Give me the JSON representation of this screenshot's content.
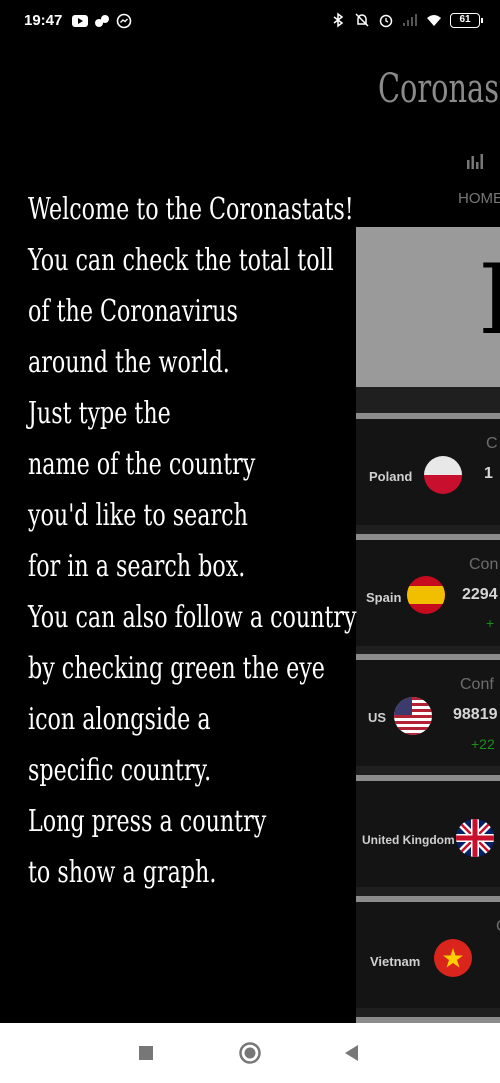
{
  "status_bar": {
    "time": "19:47",
    "battery": "61",
    "left_icons": [
      "youtube-icon",
      "notification-icon",
      "messenger-icon"
    ],
    "right_icons": [
      "bluetooth-icon",
      "mute-icon",
      "alarm-icon",
      "signal-icon",
      "wifi-icon",
      "battery-icon"
    ]
  },
  "app": {
    "title": "Coronastats",
    "nav_home": "HOME",
    "hero_letter": "F",
    "cards": [
      {
        "country": "Poland",
        "label": "C",
        "value": "1",
        "delta": ""
      },
      {
        "country": "Spain",
        "label": "Con",
        "value": "2294",
        "delta": "+"
      },
      {
        "country": "US",
        "label": "Conf",
        "value": "98819",
        "delta": "+22"
      },
      {
        "country": "United Kingdom",
        "label": "",
        "value": "",
        "delta": ""
      },
      {
        "country": "Vietnam",
        "label": "C",
        "value": "",
        "delta": ""
      }
    ]
  },
  "drawer": {
    "lines": [
      "Welcome to the Coronastats!",
      "You can check the total toll",
      "of the Coronavirus",
      "around the world.",
      "Just type the",
      "name of the country",
      "you'd like to search",
      "for in a search box.",
      "You can also follow a country",
      "by checking green the eye",
      "icon alongside a",
      "specific country.",
      "Long press a country",
      "to show a graph."
    ]
  },
  "colors": {
    "background": "#000000",
    "card": "#141414",
    "card_border": "#8c8c8c",
    "hero": "#9a9a9a",
    "delta_green": "#1a8f1a",
    "nav_bar": "#ffffff"
  }
}
